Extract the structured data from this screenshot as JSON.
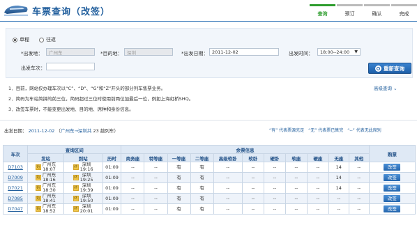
{
  "header": {
    "title": "车票查询（改签）",
    "steps": [
      "查询",
      "预订",
      "确认",
      "完成"
    ]
  },
  "form": {
    "trip_oneway": "单程",
    "trip_round": "往返",
    "from_label": "*出发地：",
    "from_value": "广州东",
    "to_label": "*目的地：",
    "to_value": "深圳",
    "date_label": "*出发日期：",
    "date_value": "2011-12-02",
    "time_label": "出发时间：",
    "time_value": "18:00--24:00",
    "train_label": "出发车次：",
    "train_value": "",
    "search_label": "重新查询"
  },
  "notes": [
    "1．目前，网站仅办理车次以“C”、“D”、“G”和“Z”开头的部分列车售票业务。",
    "2．简码为车站简拼的前三位，简码超过三位时使用前两位加最后一位，例如上海虹桥SHQ。",
    "3．改签车票时，不能变更出发地、目的地、席种和身份信息。"
  ],
  "advanced_label": "高级查询 ⌄",
  "summary": {
    "prefix": "出发日期：",
    "date": "2011-12-02",
    "route": "广州东→深圳共",
    "count": "23",
    "suffix": "趟列车）"
  },
  "legend": "“有” 代表票源充足　“无” 代表票已售完　“--” 代表无此席别",
  "table": {
    "group_headers": [
      "车次",
      "查询区间",
      "余票信息",
      "购票"
    ],
    "headers": [
      "发站",
      "到站",
      "历时",
      "商务座",
      "特等座",
      "一等座",
      "二等座",
      "高级软卧",
      "软卧",
      "硬卧",
      "软座",
      "硬座",
      "无座",
      "其他"
    ],
    "rows": [
      {
        "train": "D7103",
        "from": "广州东",
        "dep": "18:07",
        "to": "深圳",
        "arr": "19:16",
        "dur": "01:09",
        "seats": [
          "--",
          "--",
          "有",
          "有",
          "--",
          "--",
          "--",
          "--",
          "--",
          "14",
          "--"
        ],
        "book": "改签"
      },
      {
        "train": "D7009",
        "from": "广州东",
        "dep": "18:16",
        "to": "深圳",
        "arr": "19:25",
        "dur": "01:09",
        "seats": [
          "--",
          "--",
          "有",
          "有",
          "--",
          "--",
          "--",
          "--",
          "--",
          "14",
          "--"
        ],
        "book": "改签"
      },
      {
        "train": "D7021",
        "from": "广州东",
        "dep": "18:30",
        "to": "深圳",
        "arr": "19:39",
        "dur": "01:09",
        "seats": [
          "--",
          "--",
          "有",
          "有",
          "--",
          "--",
          "--",
          "--",
          "--",
          "14",
          "--"
        ],
        "book": "改签"
      },
      {
        "train": "D7085",
        "from": "广州东",
        "dep": "18:41",
        "to": "深圳",
        "arr": "19:50",
        "dur": "01:09",
        "seats": [
          "--",
          "--",
          "有",
          "有",
          "--",
          "--",
          "--",
          "--",
          "--",
          "--",
          "--"
        ],
        "book": "改签"
      },
      {
        "train": "D7047",
        "from": "广州东",
        "dep": "18:52",
        "to": "深圳",
        "arr": "20:01",
        "dur": "01:09",
        "seats": [
          "--",
          "--",
          "有",
          "有",
          "--",
          "--",
          "--",
          "--",
          "--",
          "--",
          "--"
        ],
        "book": "改签"
      }
    ]
  }
}
